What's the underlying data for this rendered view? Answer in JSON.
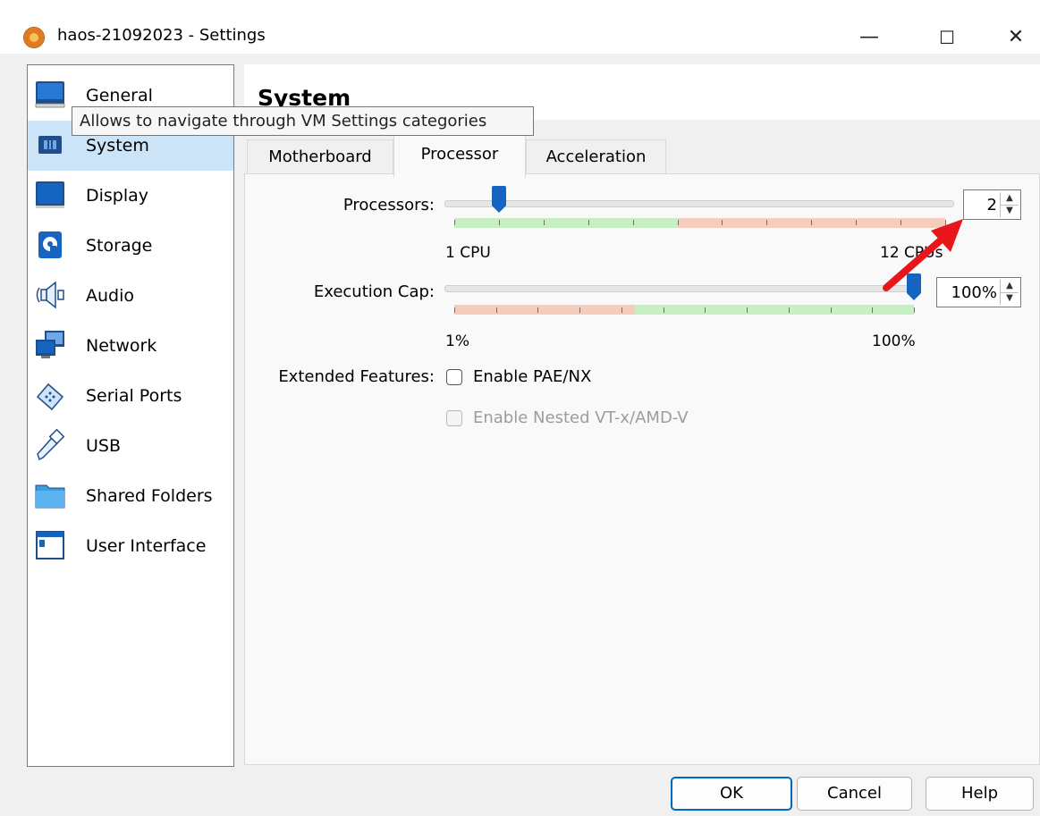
{
  "window": {
    "title": "haos-21092023 - Settings",
    "minimize_glyph": "—",
    "maximize_glyph": "☐",
    "close_glyph": "✕"
  },
  "sidebar": {
    "items": [
      {
        "label": "General",
        "icon": "monitor-icon"
      },
      {
        "label": "System",
        "icon": "chip-icon",
        "selected": true
      },
      {
        "label": "Display",
        "icon": "display-icon"
      },
      {
        "label": "Storage",
        "icon": "disk-icon"
      },
      {
        "label": "Audio",
        "icon": "speaker-icon"
      },
      {
        "label": "Network",
        "icon": "network-icon"
      },
      {
        "label": "Serial Ports",
        "icon": "serial-port-icon"
      },
      {
        "label": "USB",
        "icon": "usb-icon"
      },
      {
        "label": "Shared Folders",
        "icon": "folder-icon"
      },
      {
        "label": "User Interface",
        "icon": "window-icon"
      }
    ]
  },
  "tooltip": "Allows to navigate through VM Settings categories",
  "page": {
    "title": "System"
  },
  "tabs": [
    {
      "label": "Motherboard",
      "active": false
    },
    {
      "label": "Processor",
      "active": true
    },
    {
      "label": "Acceleration",
      "active": false
    }
  ],
  "processor": {
    "processors_label": "Processors:",
    "processors_value": "2",
    "processors_min_label": "1 CPU",
    "processors_max_label": "12 CPUs",
    "processors_min": 1,
    "processors_max": 12,
    "processors_recommended_max": 6,
    "exec_cap_label": "Execution Cap:",
    "exec_cap_value": "100%",
    "exec_cap_min_label": "1%",
    "exec_cap_max_label": "100%",
    "exec_cap_min": 1,
    "exec_cap_max": 100,
    "exec_cap_warning_below": 40,
    "extended_features_label": "Extended Features:",
    "pae_label": "Enable PAE/NX",
    "pae_checked": false,
    "nested_vt_label": "Enable Nested VT-x/AMD-V",
    "nested_vt_checked": false,
    "nested_vt_enabled": false
  },
  "buttons": {
    "ok": "OK",
    "cancel": "Cancel",
    "help": "Help"
  },
  "colors": {
    "selection": "#cce4f7",
    "slider_thumb": "#1565c0",
    "safe_band": "#c6efc2",
    "warning_band": "#f6cdbd",
    "annotation_arrow": "#e8151b",
    "primary_border": "#0067c0"
  }
}
